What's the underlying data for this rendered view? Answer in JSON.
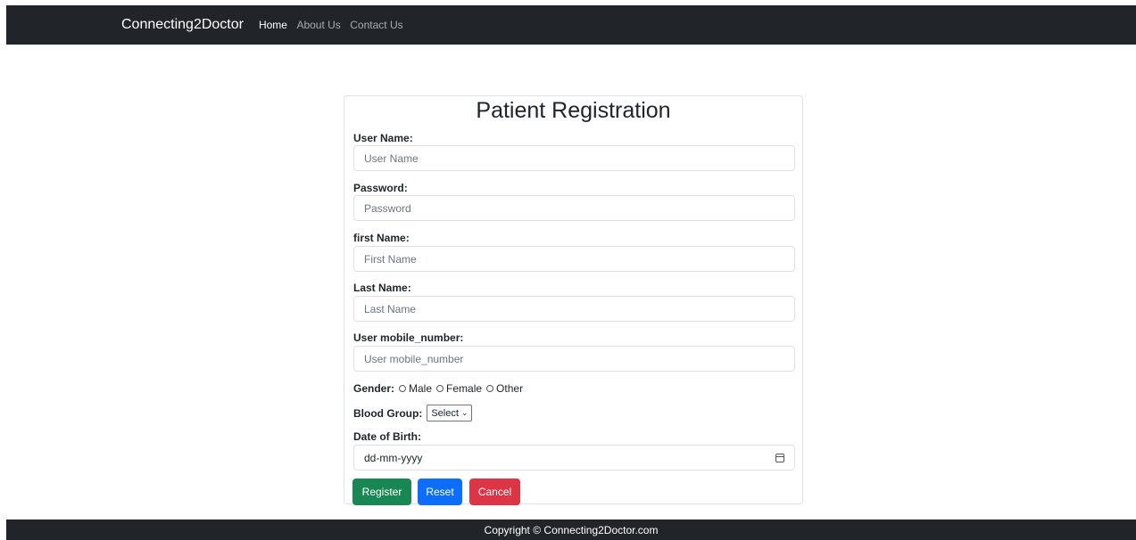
{
  "navbar": {
    "brand": "Connecting2Doctor",
    "links": [
      "Home",
      "About Us",
      "Contact Us"
    ]
  },
  "form": {
    "title": "Patient Registration",
    "username": {
      "label": "User Name:",
      "placeholder": "User Name"
    },
    "password": {
      "label": "Password:",
      "placeholder": "Password"
    },
    "first_name": {
      "label": "first Name:",
      "placeholder": "First Name"
    },
    "last_name": {
      "label": "Last Name:",
      "placeholder": "Last Name"
    },
    "mobile": {
      "label": "User mobile_number:",
      "placeholder": "User mobile_number"
    },
    "gender": {
      "label": "Gender:",
      "options": [
        "Male",
        "Female",
        "Other"
      ]
    },
    "blood_group": {
      "label": "Blood Group:",
      "selected": "Select"
    },
    "dob": {
      "label": "Date of Birth:",
      "placeholder": "dd-mm-yyyy"
    },
    "buttons": {
      "register": "Register",
      "reset": "Reset",
      "cancel": "Cancel"
    }
  },
  "colors": {
    "navbar_bg": "#212529",
    "success": "#198754",
    "primary": "#0d6efd",
    "danger": "#dc3545"
  },
  "footer": {
    "text": "Copyright © Connecting2Doctor.com"
  }
}
